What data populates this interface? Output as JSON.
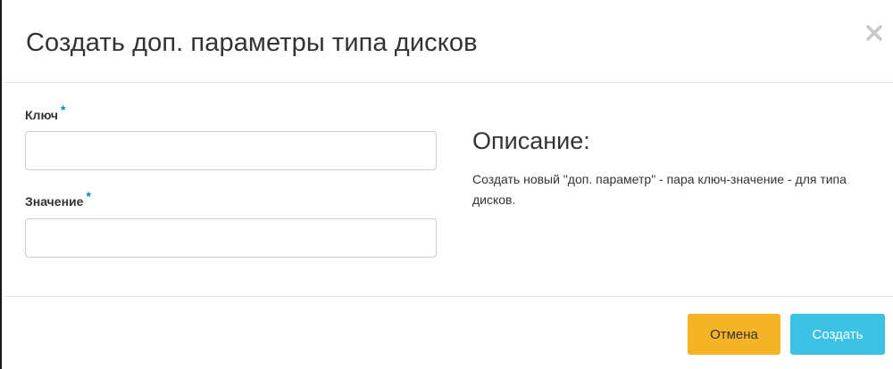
{
  "dialog": {
    "title": "Создать доп. параметры типа дисков",
    "close_icon": "close-icon"
  },
  "form": {
    "key_label": "Ключ",
    "key_value": "",
    "value_label": "Значение",
    "value_value": "",
    "required_marker": "*"
  },
  "description": {
    "heading": "Описание:",
    "text": "Создать новый \"доп. параметр\" - пара ключ-значение - для типа дисков."
  },
  "footer": {
    "cancel_label": "Отмена",
    "create_label": "Создать"
  },
  "colors": {
    "required_star": "#0088cc",
    "cancel_button": "#f5b425",
    "create_button": "#3cc2e5"
  }
}
